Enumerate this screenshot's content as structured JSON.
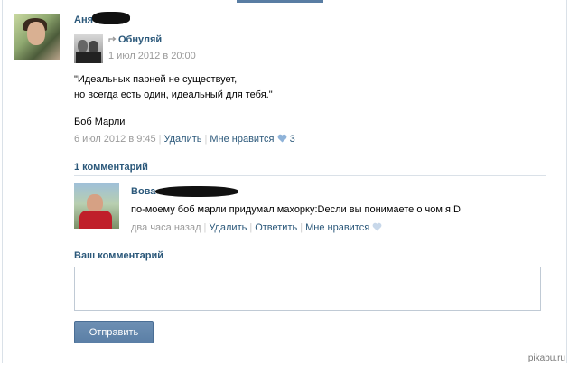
{
  "post": {
    "author": "Аня",
    "repost_icon": "repost-arrow-icon",
    "repost_source": "Обнуляй",
    "repost_date": "1 июл 2012 в 20:00",
    "text_line1": "\"Идеальных парней не существует,",
    "text_line2": "но всегда есть один, идеальный для тебя.\"",
    "signature": "Боб Марли",
    "date": "6 июл 2012 в 9:45",
    "delete_label": "Удалить",
    "like_label": "Мне нравится",
    "like_count": "3"
  },
  "comments": {
    "count_label": "1 комментарий",
    "items": [
      {
        "author": "Вова",
        "text": "по-моему боб марли придумал махорку:Dесли вы понимаете о чом я:D",
        "time": "два часа назад",
        "delete_label": "Удалить",
        "reply_label": "Ответить",
        "like_label": "Мне нравится"
      }
    ]
  },
  "compose": {
    "title": "Ваш комментарий",
    "value": "",
    "submit_label": "Отправить"
  },
  "watermark": "pikabu.ru",
  "colors": {
    "link": "#2b587a",
    "gray": "#999999",
    "heart": "#8fb3d9",
    "heart_empty": "#c8d8ea",
    "button": "#5b7fa6"
  }
}
